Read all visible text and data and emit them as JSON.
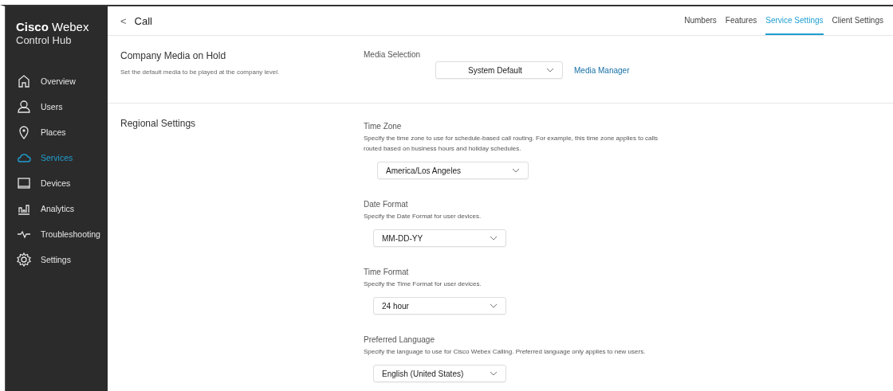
{
  "brand": {
    "name": "Cisco",
    "product": "Webex",
    "subtitle": "Control Hub"
  },
  "sidebar": {
    "items": [
      {
        "label": "Overview",
        "kind": "home",
        "selected": false
      },
      {
        "label": "Users",
        "kind": "user",
        "selected": false
      },
      {
        "label": "Places",
        "kind": "pin",
        "selected": false
      },
      {
        "label": "Services",
        "kind": "cloud",
        "selected": true
      },
      {
        "label": "Devices",
        "kind": "device",
        "selected": false
      },
      {
        "label": "Analytics",
        "kind": "chart",
        "selected": false
      },
      {
        "label": "Troubleshooting",
        "kind": "pulse",
        "selected": false
      },
      {
        "label": "Settings",
        "kind": "gear",
        "selected": false
      }
    ]
  },
  "header": {
    "back": "<",
    "title": "Call",
    "tabs": [
      {
        "label": "Numbers",
        "selected": false
      },
      {
        "label": "Features",
        "selected": false
      },
      {
        "label": "Service Settings",
        "selected": true
      },
      {
        "label": "Client Settings",
        "selected": false
      }
    ]
  },
  "sections": [
    {
      "title": "Company Media on Hold",
      "description": "Set the default media to be played at the company level.",
      "fields": [
        {
          "label": "Media Selection",
          "value": "System Default",
          "link": "Media Manager"
        }
      ]
    },
    {
      "title": "Regional Settings",
      "fields": [
        {
          "label": "Time Zone",
          "description": "Specify the time zone to use for schedule-based call routing. For example, this time zone applies to calls routed based on business hours and holiday schedules.",
          "value": "America/Los Angeles"
        },
        {
          "label": "Date Format",
          "description": "Specify the Date Format for user devices.",
          "value": "MM-DD-YY"
        },
        {
          "label": "Time Format",
          "description": "Specify the Time Format for user devices.",
          "value": "24 hour"
        },
        {
          "label": "Preferred Language",
          "description": "Specify the language to use for Cisco Webex Calling. Preferred language only applies to new users.",
          "value": "English (United States)"
        }
      ]
    }
  ]
}
